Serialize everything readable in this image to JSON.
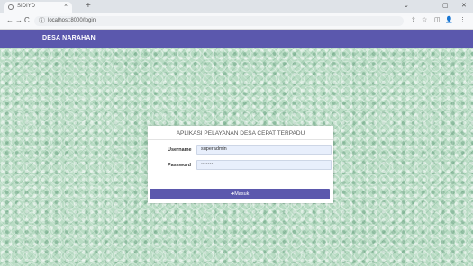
{
  "browser": {
    "tab_title": "SIDIYD",
    "tab_close": "×",
    "new_tab": "+",
    "url_info_icon": "ⓘ",
    "url": "localhost:8000/login",
    "win_min": "−",
    "win_max": "▢",
    "win_close": "✕",
    "win_chevron": "⌄",
    "nav_back": "←",
    "nav_forward": "→",
    "nav_reload": "C",
    "tb_share": "⇪",
    "tb_star": "☆",
    "tb_sidepanel": "◫",
    "tb_profile": "👤",
    "tb_menu": "⋮"
  },
  "header": {
    "brand": "DESA NARAHAN",
    "color": "#5b58ad"
  },
  "login": {
    "title": "APLIKASI PELAYANAN DESA CEPAT TERPADU",
    "username_label": "Username",
    "username_value": "superadmin",
    "password_label": "Password",
    "password_value": "•••••••",
    "button_label": "➜Masuk"
  }
}
